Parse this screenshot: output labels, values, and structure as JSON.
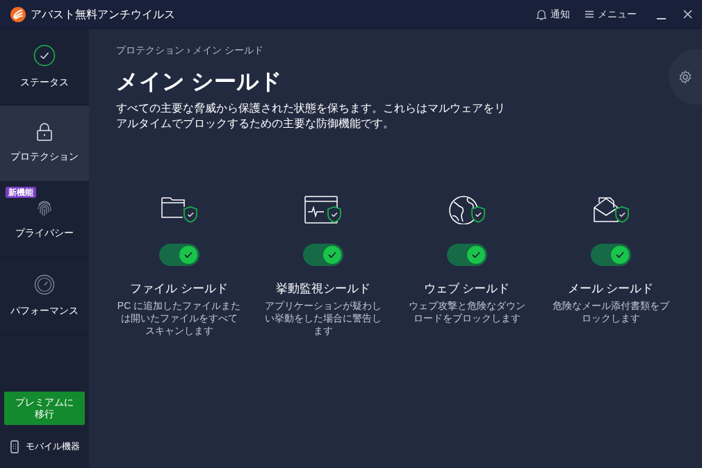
{
  "window": {
    "title": "アバスト無料アンチウイルス"
  },
  "header_actions": [
    {
      "label": "通知"
    },
    {
      "label": "メニュー"
    }
  ],
  "sidebar": {
    "items": [
      {
        "label": "ステータス",
        "selected": false
      },
      {
        "label": "プロテクション",
        "selected": true
      },
      {
        "label": "プライバシー",
        "selected": false,
        "badge": "新機能"
      },
      {
        "label": "パフォーマンス",
        "selected": false
      }
    ],
    "upgrade_button": "プレミアムに移行",
    "mobile_link": "モバイル機器"
  },
  "breadcrumb": "プロテクション › メイン シールド",
  "page_title": "メイン シールド",
  "description": "すべての主要な脅威から保護された状態を保ちます。これらはマルウェアをリアルタイムでブロックするための主要な防御機能です。",
  "shields": [
    {
      "title": "ファイル シールド",
      "description": "PC に追加したファイルまたは開いたファイルをすべてスキャンします",
      "on": true
    },
    {
      "title": "挙動監視シールド",
      "description": "アプリケーションが疑わしい挙動をした場合に警告します",
      "on": true
    },
    {
      "title": "ウェブ シールド",
      "description": "ウェブ攻撃と危険なダウンロードをブロックします",
      "on": true
    },
    {
      "title": "メール シールド",
      "description": "危険なメール添付書類をブロックします",
      "on": true
    }
  ]
}
